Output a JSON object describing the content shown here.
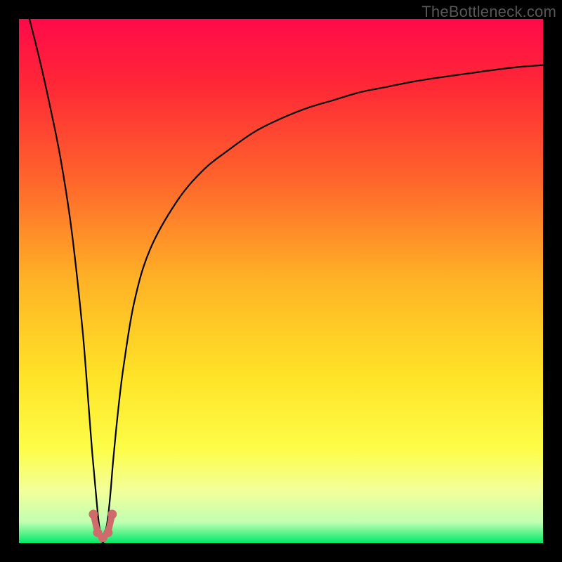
{
  "attribution": "TheBottleneck.com",
  "chart_data": {
    "type": "line",
    "title": "",
    "xlabel": "",
    "ylabel": "",
    "xlim": [
      0,
      100
    ],
    "ylim": [
      0,
      100
    ],
    "background": {
      "type": "vertical-gradient",
      "stops": [
        {
          "pos": 0.0,
          "color": "#ff0a4a"
        },
        {
          "pos": 0.12,
          "color": "#ff2637"
        },
        {
          "pos": 0.3,
          "color": "#ff622c"
        },
        {
          "pos": 0.5,
          "color": "#ffb326"
        },
        {
          "pos": 0.68,
          "color": "#ffe327"
        },
        {
          "pos": 0.82,
          "color": "#fdfd47"
        },
        {
          "pos": 0.9,
          "color": "#f3ff9a"
        },
        {
          "pos": 0.96,
          "color": "#c1ffb2"
        },
        {
          "pos": 1.0,
          "color": "#00e968"
        }
      ]
    },
    "series": [
      {
        "name": "bottleneck-curve",
        "note": "y = estimated bottleneck % (0 at minimum, 100 at top). Curve drops sharply to ~0 near x≈16 then rises asymptotically.",
        "x": [
          2,
          4,
          6,
          8,
          10,
          12,
          13,
          14,
          15,
          15.5,
          16,
          16.5,
          17,
          17.5,
          18,
          19,
          20,
          22,
          25,
          30,
          35,
          40,
          45,
          50,
          55,
          60,
          65,
          70,
          75,
          80,
          85,
          90,
          95,
          100
        ],
        "y": [
          100,
          92,
          83,
          73,
          60,
          42,
          30,
          17,
          6,
          2,
          0,
          2,
          5,
          10,
          16,
          26,
          34,
          46,
          56,
          65,
          71,
          75,
          78.5,
          81,
          83,
          84.5,
          86,
          87,
          88,
          88.8,
          89.5,
          90.2,
          90.8,
          91.2
        ]
      }
    ],
    "markers": {
      "note": "small pink/coral dots near curve minimum",
      "color": "#cf6b6b",
      "points": [
        {
          "x": 14.2,
          "y": 5.5
        },
        {
          "x": 15.0,
          "y": 2.0
        },
        {
          "x": 16.0,
          "y": 1.0
        },
        {
          "x": 17.0,
          "y": 2.0
        },
        {
          "x": 17.8,
          "y": 5.5
        }
      ]
    }
  }
}
